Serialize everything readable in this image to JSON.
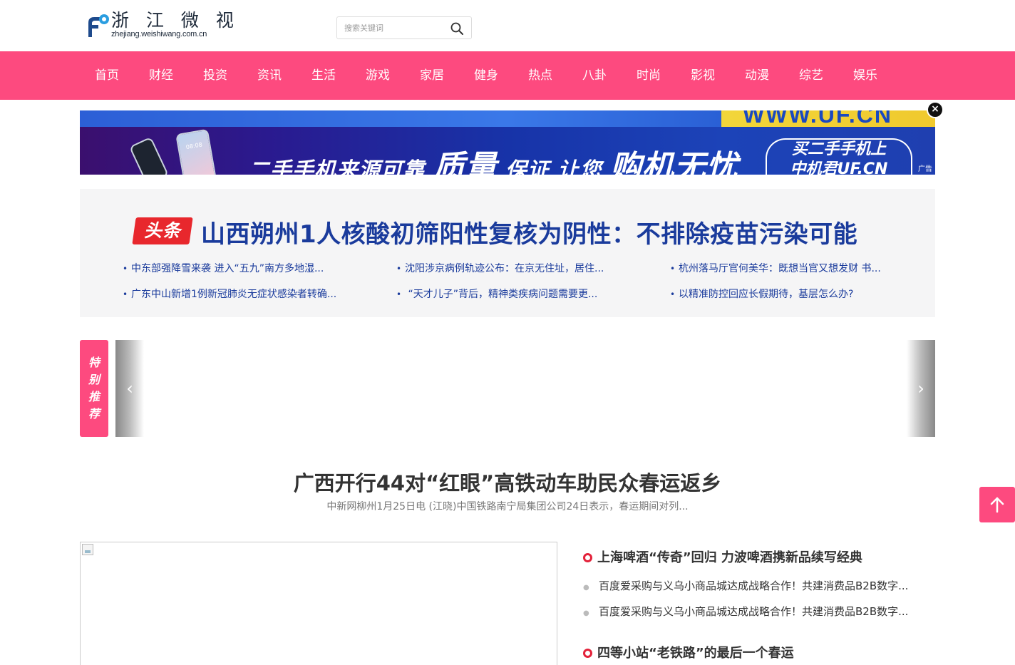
{
  "header": {
    "logo_cn": "浙 江 微 视",
    "logo_en": "zhejiang.weishiwang.com.cn",
    "search_placeholder": "搜索关键词"
  },
  "nav": {
    "items": [
      "首页",
      "财经",
      "投资",
      "资讯",
      "生活",
      "游戏",
      "家居",
      "健身",
      "热点",
      "八卦",
      "时尚",
      "影视",
      "动漫",
      "综艺",
      "娱乐"
    ]
  },
  "banner": {
    "top_fragment": "WWW.UF.CN",
    "slogan_a": "二手手机来源可靠",
    "slogan_b": "质量",
    "slogan_c": "保证 让您",
    "slogan_d": "购机无忧",
    "right_line1": "买二手手机上",
    "right_line2": "中机君UF.CN",
    "ad_label": "广告",
    "close": "×",
    "phone_time": "08:08"
  },
  "headline": {
    "tag": "头条",
    "title": "山西朔州1人核酸初筛阳性复核为阴性：不排除疫苗污染可能",
    "links": [
      "中东部强降雪来袭 进入“五九”南方多地湿...",
      "沈阳涉京病例轨迹公布：在京无住址，居住...",
      "杭州落马厅官何美华：既想当官又想发财 书...",
      "广东中山新增1例新冠肺炎无症状感染者转确...",
      " “天才儿子”背后，精神类疾病问题需要更...",
      "以精准防控回应长假期待，基层怎么办?"
    ]
  },
  "recommend": {
    "tag_chars": [
      "特",
      "别",
      "推",
      "荐"
    ],
    "prev": "‹",
    "next": "›"
  },
  "feature": {
    "title": "广西开行44对“红眼”高铁动车助民众春运返乡",
    "desc": "中新网柳州1月25日电 (江晓)中国铁路南宁局集团公司24日表示，春运期间对列..."
  },
  "news": {
    "head1": "上海啤酒“传奇”回归 力波啤酒携新品续写经典",
    "sub1": "百度爱采购与义乌小商品城达成战略合作！共建消费品B2B数字...",
    "sub2": "百度爱采购与义乌小商品城达成战略合作！共建消费品B2B数字...",
    "head2": "四等小站“老铁路”的最后一个春运"
  },
  "colors": {
    "brand_pink": "#fd4a7f",
    "headline_blue": "#1a3b9c",
    "toutiao_red": "#e8272d",
    "news_ring_red": "#e3223a"
  }
}
